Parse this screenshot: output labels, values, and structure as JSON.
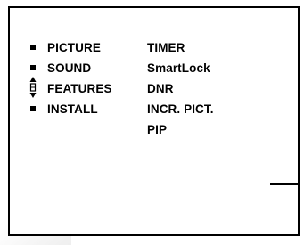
{
  "main_menu": {
    "items": [
      {
        "label": "PICTURE"
      },
      {
        "label": "SOUND"
      },
      {
        "label": "FEATURES",
        "selected": true
      },
      {
        "label": "INSTALL"
      }
    ]
  },
  "submenu": {
    "items": [
      {
        "label": "TIMER"
      },
      {
        "label": "SmartLock"
      },
      {
        "label": "DNR"
      },
      {
        "label": "INCR. PICT."
      },
      {
        "label": "PIP"
      }
    ]
  },
  "icons": {
    "bullet": "square-bullet-icon",
    "selection": "up-down-arrows-icon"
  },
  "colors": {
    "text": "#000000",
    "background": "#ffffff",
    "frame": "#000000"
  }
}
